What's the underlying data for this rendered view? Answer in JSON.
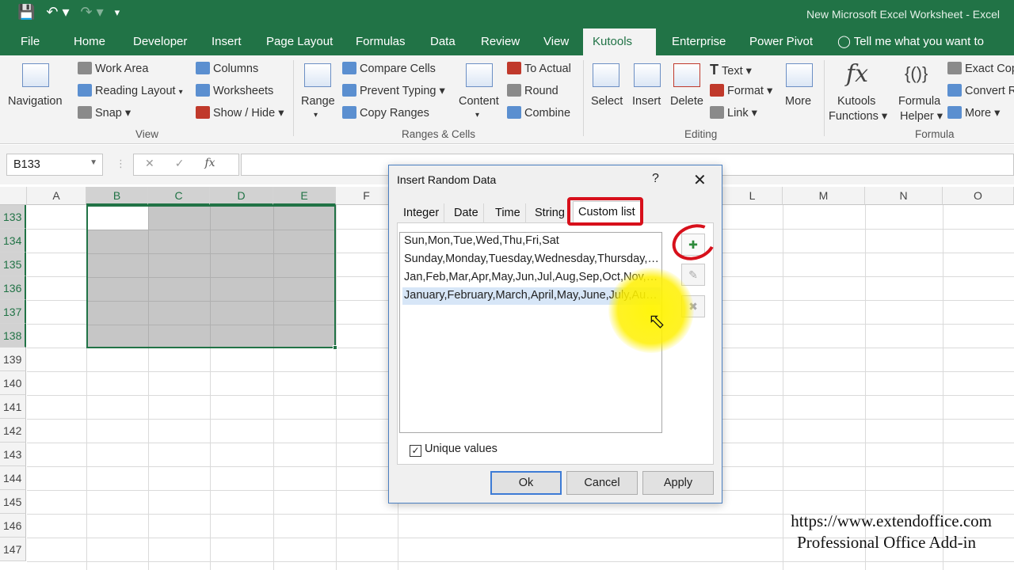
{
  "window": {
    "title": "New Microsoft Excel Worksheet - Excel"
  },
  "quick_access": {
    "icons": [
      "save-icon",
      "undo-icon",
      "redo-icon",
      "customize-icon"
    ]
  },
  "ribbon_tabs": [
    "File",
    "Home",
    "Developer",
    "Insert",
    "Page Layout",
    "Formulas",
    "Data",
    "Review",
    "View",
    "Kutools ™",
    "Enterprise",
    "Power Pivot",
    "Tell me what you want to do..."
  ],
  "active_tab": "Kutools ™",
  "ribbon": {
    "navigation": "Navigation",
    "work_area": "Work Area",
    "reading_layout": "Reading Layout",
    "snap": "Snap ▾",
    "columns": "Columns",
    "worksheets": "Worksheets",
    "show_hide": "Show / Hide ▾",
    "view_group": "View",
    "range": "Range",
    "compare_cells": "Compare Cells",
    "prevent_typing": "Prevent Typing ▾",
    "copy_ranges": "Copy Ranges",
    "content": "Content",
    "to_actual": "To Actual",
    "round": "Round",
    "combine": "Combine",
    "ranges_group": "Ranges & Cells",
    "select": "Select",
    "insert": "Insert",
    "delete": "Delete",
    "text": "Text ▾",
    "format": "Format ▾",
    "link": "Link ▾",
    "more": "More",
    "editing_group": "Editing",
    "kutools_functions_1": "Kutools",
    "kutools_functions_2": "Functions ▾",
    "formula_helper_1": "Formula",
    "formula_helper_2": "Helper ▾",
    "exact_copy": "Exact Cop",
    "convert_ref": "Convert R",
    "more2": "More ▾",
    "formula_group": "Formula"
  },
  "formula_bar": {
    "name_box": "B133",
    "fx": "fx",
    "value": ""
  },
  "grid": {
    "columns": [
      "A",
      "B",
      "C",
      "D",
      "E",
      "F",
      "L",
      "M",
      "N",
      "O"
    ],
    "rows": [
      "133",
      "134",
      "135",
      "136",
      "137",
      "138",
      "139",
      "140",
      "141",
      "142",
      "143",
      "144",
      "145",
      "146",
      "147"
    ],
    "selection": "B133:E138"
  },
  "dialog": {
    "title": "Insert Random Data",
    "help": "?",
    "close": "✕",
    "tabs": [
      "Integer",
      "Date",
      "Time",
      "String",
      "Custom list"
    ],
    "active_tab": "Custom list",
    "list_items": [
      "Sun,Mon,Tue,Wed,Thu,Fri,Sat",
      "Sunday,Monday,Tuesday,Wednesday,Thursday,Friday,Saturday",
      "Jan,Feb,Mar,Apr,May,Jun,Jul,Aug,Sep,Oct,Nov,Dec",
      "January,February,March,April,May,June,July,August,September,October,November,December"
    ],
    "selected_index": 3,
    "unique_values": "Unique values",
    "unique_checked": true,
    "ok": "Ok",
    "cancel": "Cancel",
    "apply": "Apply"
  },
  "watermark": {
    "url": "https://www.extendoffice.com",
    "tagline": "Professional Office Add-in"
  },
  "colors": {
    "excel_green": "#217346",
    "highlight_red": "#d7101b",
    "spotlight_yellow": "#fff200"
  }
}
